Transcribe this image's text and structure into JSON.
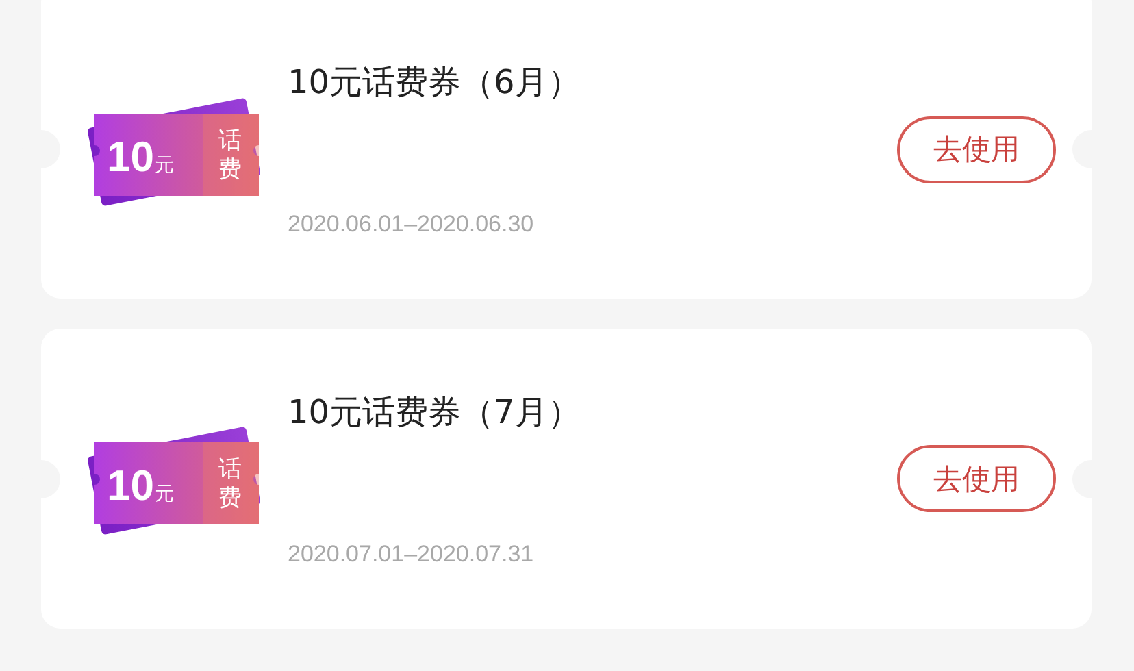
{
  "coupons": [
    {
      "ticket": {
        "amount": "10",
        "unit": "元",
        "tag": "话费"
      },
      "title": "10元话费券（6月）",
      "validity": "2020.06.01–2020.06.30",
      "button": "去使用"
    },
    {
      "ticket": {
        "amount": "10",
        "unit": "元",
        "tag": "话费"
      },
      "title": "10元话费券（7月）",
      "validity": "2020.07.01–2020.07.31",
      "button": "去使用"
    }
  ]
}
